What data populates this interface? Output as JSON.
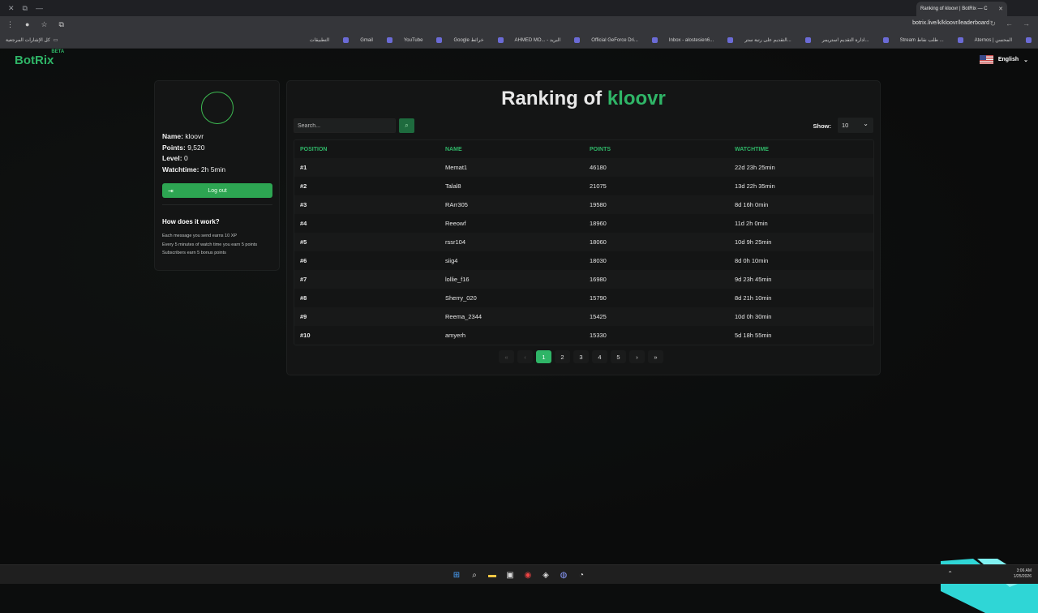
{
  "browser": {
    "tab_title": "Ranking of kloovr | BotRix — C",
    "url": "botrix.live/k/kloovr/leaderboard",
    "bookmarks_left": "كل الإشارات المرجعية",
    "bookmarks": [
      "Aternos | المحسن",
      "Stream طلب نقاط ...",
      "ادارة التقديم استريمر...",
      "التقديم على رتبة ستر...",
      "Inbox - alostesien6...",
      "Official GeForce Dri...",
      "AHMED MO... - البريد",
      "Google خرائط",
      "YouTube",
      "Gmail",
      "التطبيقات"
    ]
  },
  "site": {
    "logo": "BotRix",
    "logo_badge": "BETA",
    "language": "English"
  },
  "profile": {
    "name_label": "Name:",
    "name": "kloovr",
    "points_label": "Points:",
    "points": "9,520",
    "level_label": "Level:",
    "level": "0",
    "watchtime_label": "Watchtime:",
    "watchtime": "2h 5min",
    "logout": "Log out",
    "how_title": "How does it work?",
    "how_lines": [
      "Each message you send earns 10 XP",
      "Every 5 minutes of watch time you earn 5 points",
      "Subscribers earn 5 bonus points"
    ]
  },
  "ranking": {
    "title_prefix": "Ranking of",
    "title_name": "kloovr",
    "search_placeholder": "Search...",
    "show_label": "Show:",
    "show_value": "10",
    "columns": [
      "POSITION",
      "NAME",
      "POINTS",
      "WATCHTIME"
    ],
    "rows": [
      [
        "#1",
        "Memat1",
        "46180",
        "22d 23h 25min"
      ],
      [
        "#2",
        "Talal8",
        "21075",
        "13d 22h 35min"
      ],
      [
        "#3",
        "RArr305",
        "19580",
        "8d 16h 0min"
      ],
      [
        "#4",
        "Reeowf",
        "18960",
        "11d 2h 0min"
      ],
      [
        "#5",
        "rssr104",
        "18060",
        "10d 9h 25min"
      ],
      [
        "#6",
        "siig4",
        "18030",
        "8d 0h 10min"
      ],
      [
        "#7",
        "lollie_f16",
        "16980",
        "9d 23h 45min"
      ],
      [
        "#8",
        "Sherry_020",
        "15790",
        "8d 21h 10min"
      ],
      [
        "#9",
        "Reema_2344",
        "15425",
        "10d 0h 30min"
      ],
      [
        "#10",
        "amyerh",
        "15330",
        "5d 18h 55min"
      ]
    ],
    "pages": [
      "1",
      "2",
      "3",
      "4",
      "5"
    ]
  },
  "taskbar": {
    "time": "3:06 AM",
    "date": "1/25/2026"
  }
}
